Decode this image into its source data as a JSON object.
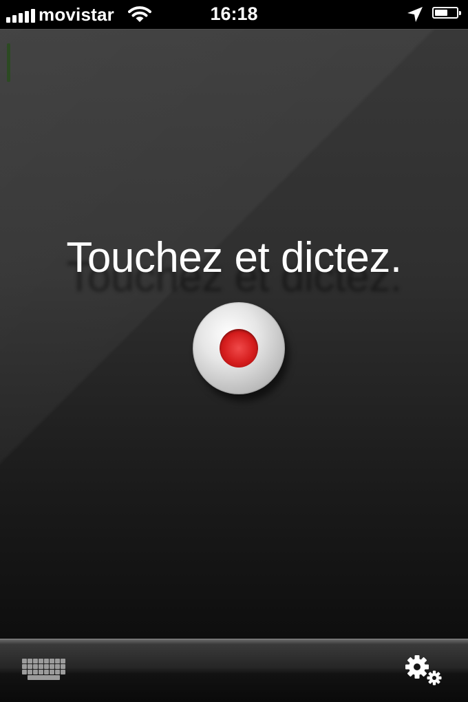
{
  "status_bar": {
    "carrier": "movistar",
    "time": "16:18",
    "signal_bars": 5,
    "battery_level_fraction": 0.6,
    "icons": [
      "signal-bars-icon",
      "wifi-icon",
      "location-arrow-icon",
      "battery-icon"
    ]
  },
  "main": {
    "prompt": "Touchez et dictez.",
    "record_button_icon": "record-icon",
    "colors": {
      "record_red": "#d51d1d",
      "background_top": "#383838",
      "background_bottom": "#0e0e0e",
      "level_meter": "#2c4a22"
    }
  },
  "toolbar": {
    "left_icon": "keyboard-icon",
    "right_icon": "gears-icon"
  }
}
